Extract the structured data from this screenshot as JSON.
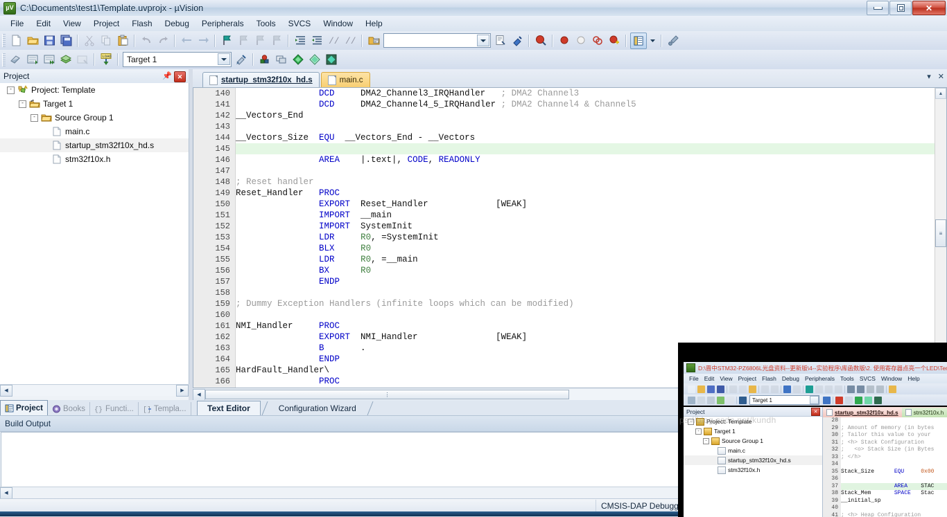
{
  "window": {
    "title": "C:\\Documents\\test1\\Template.uvprojx - µVision",
    "app_icon_label": "µV",
    "minimize_label": "Minimize",
    "restore_label": "Restore",
    "close_label": "✕"
  },
  "menubar": {
    "items": [
      "File",
      "Edit",
      "View",
      "Project",
      "Flash",
      "Debug",
      "Peripherals",
      "Tools",
      "SVCS",
      "Window",
      "Help"
    ]
  },
  "toolbar1": {
    "icons": [
      "new-file-icon",
      "open-file-icon",
      "save-icon",
      "save-all-icon",
      "cut-icon",
      "copy-icon",
      "paste-icon",
      "undo-icon",
      "redo-icon",
      "navigate-back-icon",
      "navigate-forward-icon",
      "bookmark-toggle-icon",
      "bookmark-prev-icon",
      "bookmark-next-icon",
      "bookmark-clear-icon",
      "indent-icon",
      "outdent-icon",
      "comment-icon",
      "uncomment-icon",
      "open-project-icon"
    ],
    "find_value": "",
    "find_placeholder": "",
    "extra_icons": [
      "find-in-files-icon",
      "insert-template-icon",
      "find-target-icon",
      "breakpoint-insert-icon",
      "breakpoint-disable-icon",
      "breakpoint-clear-all-icon",
      "breakpoint-disable-all-icon",
      "manage-windows-icon",
      "configure-icon"
    ]
  },
  "toolbar2": {
    "icons": [
      "translate-icon",
      "build-icon",
      "rebuild-icon",
      "batch-build-icon",
      "stop-build-icon",
      "load-icon"
    ],
    "target_value": "Target 1",
    "target_options": [
      "Target 1"
    ],
    "after_icons": [
      "target-options-icon",
      "manage-project-items-icon",
      "manage-multi-project-icon",
      "pack-installer-icon",
      "run-time-env-icon",
      "manage-run-time-icon"
    ]
  },
  "project_pane": {
    "title": "Project",
    "pin_label": "▮",
    "close_label": "✕",
    "tree": [
      {
        "label": "Project: Template",
        "depth": 0,
        "icon": "project-icon",
        "expander": "-"
      },
      {
        "label": "Target 1",
        "depth": 1,
        "icon": "target-icon",
        "expander": "-"
      },
      {
        "label": "Source Group 1",
        "depth": 2,
        "icon": "folder-icon",
        "expander": "-"
      },
      {
        "label": "main.c",
        "depth": 3,
        "icon": "file-icon",
        "expander": ""
      },
      {
        "label": "startup_stm32f10x_hd.s",
        "depth": 3,
        "icon": "file-icon",
        "expander": "",
        "selected": true
      },
      {
        "label": "stm32f10x.h",
        "depth": 3,
        "icon": "file-icon",
        "expander": ""
      }
    ],
    "bottom_tabs": [
      {
        "label": "Project",
        "icon": "project-tab-icon",
        "active": true
      },
      {
        "label": "Books",
        "icon": "books-tab-icon",
        "active": false
      },
      {
        "label": "Functi...",
        "icon": "functions-tab-icon",
        "active": false
      },
      {
        "label": "Templa...",
        "icon": "templates-tab-icon",
        "active": false
      }
    ]
  },
  "editor": {
    "tabs": [
      {
        "label": "startup_stm32f10x_hd.s",
        "active": true
      },
      {
        "label": "main.c",
        "active": false
      }
    ],
    "tab_controls": [
      "chevron-down-icon",
      "close-icon"
    ],
    "first_line_number": 140,
    "highlighted_line": 145,
    "lines": [
      {
        "n": 140,
        "segments": [
          {
            "t": "                ",
            "c": "plain"
          },
          {
            "t": "DCD",
            "c": "kw"
          },
          {
            "t": "     DMA2_Channel3_IRQHandler   ",
            "c": "plain"
          },
          {
            "t": "; DMA2 Channel3",
            "c": "cm"
          }
        ]
      },
      {
        "n": 141,
        "segments": [
          {
            "t": "                ",
            "c": "plain"
          },
          {
            "t": "DCD",
            "c": "kw"
          },
          {
            "t": "     DMA2_Channel4_5_IRQHandler ",
            "c": "plain"
          },
          {
            "t": "; DMA2 Channel4 & Channel5",
            "c": "cm"
          }
        ]
      },
      {
        "n": 142,
        "segments": [
          {
            "t": "__Vectors_End",
            "c": "plain"
          }
        ]
      },
      {
        "n": 143,
        "segments": []
      },
      {
        "n": 144,
        "segments": [
          {
            "t": "__Vectors_Size  ",
            "c": "plain"
          },
          {
            "t": "EQU",
            "c": "kw"
          },
          {
            "t": "  __Vectors_End - __Vectors",
            "c": "plain"
          }
        ]
      },
      {
        "n": 145,
        "segments": []
      },
      {
        "n": 146,
        "segments": [
          {
            "t": "                ",
            "c": "plain"
          },
          {
            "t": "AREA",
            "c": "kw"
          },
          {
            "t": "    |.text|, ",
            "c": "plain"
          },
          {
            "t": "CODE",
            "c": "kw"
          },
          {
            "t": ", ",
            "c": "plain"
          },
          {
            "t": "READONLY",
            "c": "kw"
          }
        ]
      },
      {
        "n": 147,
        "segments": []
      },
      {
        "n": 148,
        "segments": [
          {
            "t": "; Reset handler",
            "c": "cm"
          }
        ]
      },
      {
        "n": 149,
        "segments": [
          {
            "t": "Reset_Handler   ",
            "c": "plain"
          },
          {
            "t": "PROC",
            "c": "kw"
          }
        ]
      },
      {
        "n": 150,
        "segments": [
          {
            "t": "                ",
            "c": "plain"
          },
          {
            "t": "EXPORT",
            "c": "kw"
          },
          {
            "t": "  Reset_Handler             [WEAK]",
            "c": "plain"
          }
        ]
      },
      {
        "n": 151,
        "segments": [
          {
            "t": "                ",
            "c": "plain"
          },
          {
            "t": "IMPORT",
            "c": "kw"
          },
          {
            "t": "  __main",
            "c": "plain"
          }
        ]
      },
      {
        "n": 152,
        "segments": [
          {
            "t": "                ",
            "c": "plain"
          },
          {
            "t": "IMPORT",
            "c": "kw"
          },
          {
            "t": "  SystemInit",
            "c": "plain"
          }
        ]
      },
      {
        "n": 153,
        "segments": [
          {
            "t": "                ",
            "c": "plain"
          },
          {
            "t": "LDR",
            "c": "kw"
          },
          {
            "t": "     ",
            "c": "plain"
          },
          {
            "t": "R0",
            "c": "reg"
          },
          {
            "t": ", =SystemInit",
            "c": "plain"
          }
        ]
      },
      {
        "n": 154,
        "segments": [
          {
            "t": "                ",
            "c": "plain"
          },
          {
            "t": "BLX",
            "c": "kw"
          },
          {
            "t": "     ",
            "c": "plain"
          },
          {
            "t": "R0",
            "c": "reg"
          }
        ]
      },
      {
        "n": 155,
        "segments": [
          {
            "t": "                ",
            "c": "plain"
          },
          {
            "t": "LDR",
            "c": "kw"
          },
          {
            "t": "     ",
            "c": "plain"
          },
          {
            "t": "R0",
            "c": "reg"
          },
          {
            "t": ", =__main",
            "c": "plain"
          }
        ]
      },
      {
        "n": 156,
        "segments": [
          {
            "t": "                ",
            "c": "plain"
          },
          {
            "t": "BX",
            "c": "kw"
          },
          {
            "t": "      ",
            "c": "plain"
          },
          {
            "t": "R0",
            "c": "reg"
          }
        ]
      },
      {
        "n": 157,
        "segments": [
          {
            "t": "                ",
            "c": "plain"
          },
          {
            "t": "ENDP",
            "c": "kw"
          }
        ]
      },
      {
        "n": 158,
        "segments": []
      },
      {
        "n": 159,
        "segments": [
          {
            "t": "; Dummy Exception Handlers (infinite loops which can be modified)",
            "c": "cm"
          }
        ]
      },
      {
        "n": 160,
        "segments": []
      },
      {
        "n": 161,
        "segments": [
          {
            "t": "NMI_Handler     ",
            "c": "plain"
          },
          {
            "t": "PROC",
            "c": "kw"
          }
        ]
      },
      {
        "n": 162,
        "segments": [
          {
            "t": "                ",
            "c": "plain"
          },
          {
            "t": "EXPORT",
            "c": "kw"
          },
          {
            "t": "  NMI_Handler               [WEAK]",
            "c": "plain"
          }
        ]
      },
      {
        "n": 163,
        "segments": [
          {
            "t": "                ",
            "c": "plain"
          },
          {
            "t": "B",
            "c": "kw"
          },
          {
            "t": "       .",
            "c": "plain"
          }
        ]
      },
      {
        "n": 164,
        "segments": [
          {
            "t": "                ",
            "c": "plain"
          },
          {
            "t": "ENDP",
            "c": "kw"
          }
        ]
      },
      {
        "n": 165,
        "segments": [
          {
            "t": "HardFault_Handler\\",
            "c": "plain"
          }
        ]
      },
      {
        "n": 166,
        "segments": [
          {
            "t": "                ",
            "c": "plain"
          },
          {
            "t": "PROC",
            "c": "kw"
          }
        ]
      }
    ],
    "bottom_tabs": [
      {
        "label": "Text Editor",
        "active": true
      },
      {
        "label": "Configuration Wizard",
        "active": false
      }
    ]
  },
  "build_output": {
    "title": "Build Output",
    "content": ""
  },
  "statusbar": {
    "cells": [
      "",
      "CMSIS-DAP Debugger",
      ""
    ]
  },
  "inner_window": {
    "title": "D:\\晋中STM32-PZ6806L光盘资料--更新版\\4--实验程序\\库函数版\\2. 使用寄存器点亮一个LED\\Tem",
    "menu": [
      "File",
      "Edit",
      "View",
      "Project",
      "Flash",
      "Debug",
      "Peripherals",
      "Tools",
      "SVCS",
      "Window",
      "Help"
    ],
    "target_value": "Target 1",
    "project_pane": {
      "title": "Project",
      "tree": [
        {
          "label": "Project: Template",
          "depth": 0,
          "expander": "-"
        },
        {
          "label": "Target 1",
          "depth": 1,
          "expander": "-"
        },
        {
          "label": "Source Group 1",
          "depth": 2,
          "expander": "-"
        },
        {
          "label": "main.c",
          "depth": 3,
          "expander": ""
        },
        {
          "label": "startup_stm32f10x_hd.s",
          "depth": 3,
          "expander": "",
          "selected": true
        },
        {
          "label": "stm32f10x.h",
          "depth": 3,
          "expander": ""
        }
      ]
    },
    "editor_tabs": [
      {
        "label": "startup_stm32f10x_hd.s",
        "active": true
      },
      {
        "label": "stm32f10x.h",
        "active": false
      }
    ],
    "code_lines": [
      {
        "n": 28,
        "text": "",
        "hl": false
      },
      {
        "n": 29,
        "text": "; Amount of memory (in bytes",
        "hl": false,
        "cls": "cm"
      },
      {
        "n": 30,
        "text": "; Tailor this value to your",
        "hl": false,
        "cls": "cm"
      },
      {
        "n": 31,
        "text": "; <h> Stack Configuration",
        "hl": false,
        "cls": "cm"
      },
      {
        "n": 32,
        "text": ";   <o> Stack Size (in Bytes",
        "hl": false,
        "cls": "cm"
      },
      {
        "n": 33,
        "text": "; </h>",
        "hl": false,
        "cls": "cm"
      },
      {
        "n": 34,
        "text": "",
        "hl": false
      },
      {
        "n": 35,
        "text": "Stack_Size      EQU     0x00",
        "hl": false,
        "cls": "mix-stack"
      },
      {
        "n": 36,
        "text": "",
        "hl": false
      },
      {
        "n": 37,
        "text": "                AREA    STAC",
        "hl": true,
        "cls": "mix-area"
      },
      {
        "n": 38,
        "text": "Stack_Mem       SPACE   Stac",
        "hl": false,
        "cls": "mix-space"
      },
      {
        "n": 39,
        "text": "__initial_sp",
        "hl": false
      },
      {
        "n": 40,
        "text": "",
        "hl": false
      },
      {
        "n": 41,
        "text": "; <h> Heap Configuration",
        "hl": false,
        "cls": "cm"
      }
    ],
    "watermark": "ps://blog.csdn.net/kundh"
  },
  "colors": {
    "keyword": "#0000c8",
    "register": "#3f7f3f",
    "comment": "#9a9a9a",
    "highlight_line": "#e4f7e4",
    "title_text": "#0d2a44",
    "inner_title_text": "#cf3a2a"
  }
}
